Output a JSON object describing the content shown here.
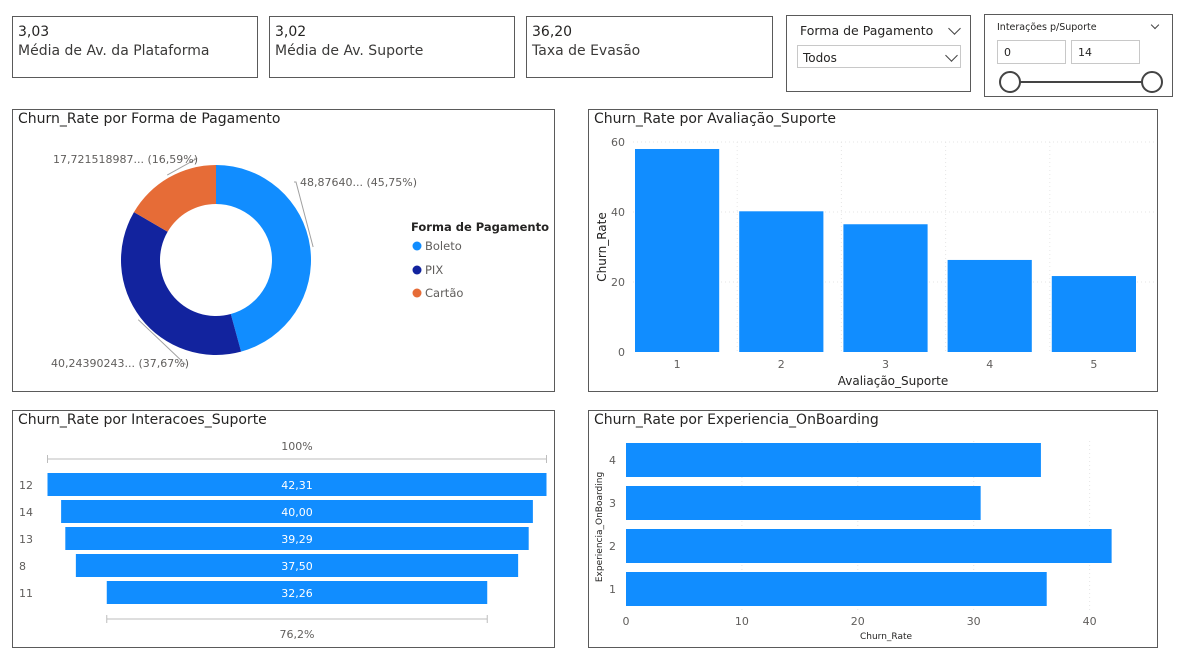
{
  "kpis": [
    {
      "value": "3,03",
      "label": "Média de Av. da Plataforma"
    },
    {
      "value": "3,02",
      "label": "Média de Av. Suporte"
    },
    {
      "value": "36,20",
      "label": "Taxa de Evasão"
    }
  ],
  "slicer_payment": {
    "title": "Forma de Pagamento",
    "selected": "Todos"
  },
  "slicer_interactions": {
    "title": "Interações p/Suporte",
    "min": "0",
    "max": "14",
    "range": [
      0,
      14
    ]
  },
  "chart_data": [
    {
      "type": "pie",
      "title": "Churn_Rate por Forma de Pagamento",
      "legend_title": "Forma de Pagamento",
      "legend_position": "right",
      "slices": [
        {
          "name": "Boleto",
          "value": 48.8764,
          "label": "48,87640... (45,75%)",
          "color": "#118dff"
        },
        {
          "name": "PIX",
          "value": 40.24390243,
          "label": "40,24390243... (37,67%)",
          "color": "#12239e"
        },
        {
          "name": "Cartão",
          "value": 17.721518987,
          "label": "17,721518987... (16,59%)",
          "color": "#e66c37"
        }
      ]
    },
    {
      "type": "bar",
      "title": "Churn_Rate por Avaliação_Suporte",
      "xlabel": "Avaliação_Suporte",
      "ylabel": "Churn_Rate",
      "categories": [
        "1",
        "2",
        "3",
        "4",
        "5"
      ],
      "values": [
        58,
        40.2,
        36.5,
        26.3,
        21.7
      ],
      "ylim": [
        0,
        60
      ],
      "yticks": [
        "0",
        "20",
        "40",
        "60"
      ],
      "color": "#118dff"
    },
    {
      "type": "bar",
      "title": "Churn_Rate por Interacoes_Suporte",
      "top_label": "100%",
      "bottom_label": "76,2%",
      "categories": [
        "12",
        "14",
        "13",
        "8",
        "11"
      ],
      "values": [
        42.31,
        40.0,
        39.29,
        37.5,
        32.26
      ],
      "value_labels": [
        "42,31",
        "40,00",
        "39,29",
        "37,50",
        "32,26"
      ],
      "color": "#118dff"
    },
    {
      "type": "bar",
      "title": "Churn_Rate por Experiencia_OnBoarding",
      "xlabel": "Churn_Rate",
      "ylabel": "Experiencia_OnBoarding",
      "categories": [
        "4",
        "3",
        "2",
        "1"
      ],
      "values": [
        35.8,
        30.6,
        41.9,
        36.3
      ],
      "xlim": [
        0,
        45
      ],
      "xticks": [
        "0",
        "10",
        "20",
        "30",
        "40"
      ],
      "color": "#118dff"
    }
  ]
}
